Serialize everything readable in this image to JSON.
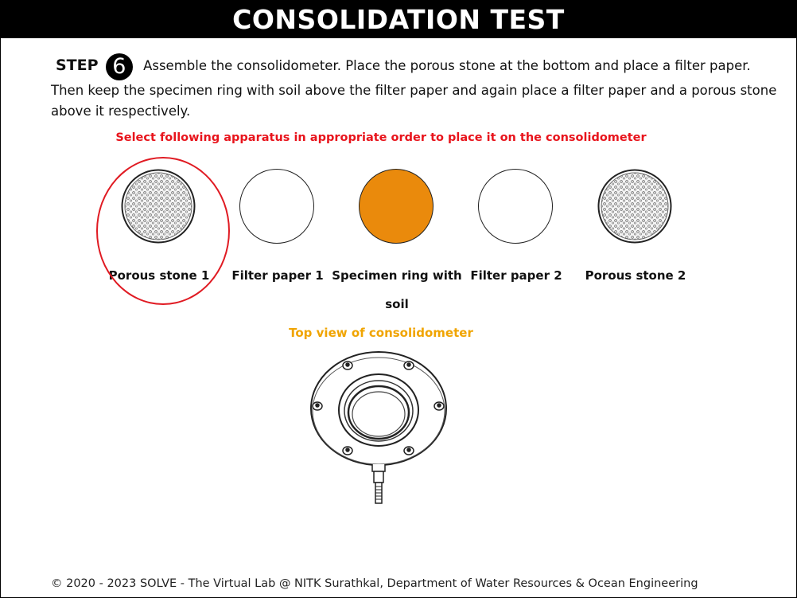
{
  "title": "CONSOLIDATION TEST",
  "step": {
    "label": "STEP",
    "number": "6",
    "text": "Assemble the consolidometer. Place the porous stone at the bottom and place a filter paper. Then keep the specimen ring with soil above the filter paper and again place a filter paper and a porous stone above it respectively."
  },
  "instruction": "Select following apparatus in appropriate order to place it on the consolidometer",
  "apparatus": [
    {
      "label": "Porous stone 1",
      "icon": "porous-stone",
      "highlighted": true
    },
    {
      "label": "Filter paper 1",
      "icon": "filter-paper"
    },
    {
      "label": "Specimen ring with soil",
      "icon": "specimen-ring",
      "color": "#ea8a0c"
    },
    {
      "label": "Filter paper 2",
      "icon": "filter-paper"
    },
    {
      "label": "Porous stone 2",
      "icon": "porous-stone"
    }
  ],
  "highlight_color": "#e01a22",
  "caption": "Top view of consolidometer",
  "footer": "© 2020 - 2023 SOLVE - The Virtual Lab @ NITK Surathkal, Department of Water Resources & Ocean Engineering"
}
